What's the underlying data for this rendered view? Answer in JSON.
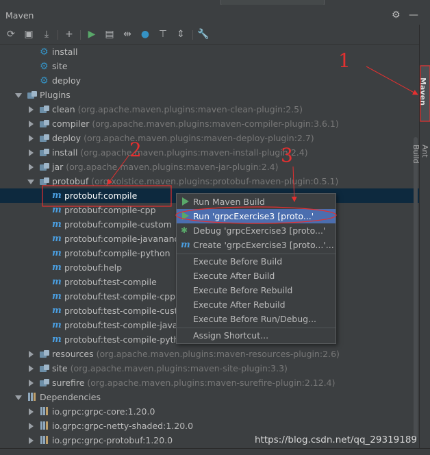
{
  "panel": {
    "title": "Maven"
  },
  "toolbar": {
    "icons": [
      "refresh-icon",
      "folder-add-icon",
      "download-icon",
      "plus-icon",
      "run-icon",
      "run-config-icon",
      "toggle-offline-icon",
      "skip-tests-icon",
      "collapse-icon",
      "expand-icon",
      "settings-wrench-icon"
    ]
  },
  "tree": {
    "lifecycle": [
      "install",
      "site",
      "deploy"
    ],
    "plugins_label": "Plugins",
    "plugins": [
      {
        "name": "clean",
        "artifact": "(org.apache.maven.plugins:maven-clean-plugin:2.5)"
      },
      {
        "name": "compiler",
        "artifact": "(org.apache.maven.plugins:maven-compiler-plugin:3.6.1)"
      },
      {
        "name": "deploy",
        "artifact": "(org.apache.maven.plugins:maven-deploy-plugin:2.7)"
      },
      {
        "name": "install",
        "artifact": "(org.apache.maven.plugins:maven-install-plugin:2.4)"
      },
      {
        "name": "jar",
        "artifact": "(org.apache.maven.plugins:maven-jar-plugin:2.4)"
      },
      {
        "name": "protobuf",
        "artifact": "(org.xolstice.maven.plugins:protobuf-maven-plugin:0.5.1)"
      }
    ],
    "goals": [
      "protobuf:compile",
      "protobuf:compile-cpp",
      "protobuf:compile-custom",
      "protobuf:compile-javanano",
      "protobuf:compile-python",
      "protobuf:help",
      "protobuf:test-compile",
      "protobuf:test-compile-cpp",
      "protobuf:test-compile-custom",
      "protobuf:test-compile-javanano",
      "protobuf:test-compile-python"
    ],
    "plugins_after": [
      {
        "name": "resources",
        "artifact": "(org.apache.maven.plugins:maven-resources-plugin:2.6)"
      },
      {
        "name": "site",
        "artifact": "(org.apache.maven.plugins:maven-site-plugin:3.3)"
      },
      {
        "name": "surefire",
        "artifact": "(org.apache.maven.plugins:maven-surefire-plugin:2.12.4)"
      }
    ],
    "dependencies_label": "Dependencies",
    "dependencies": [
      "io.grpc:grpc-core:1.20.0",
      "io.grpc:grpc-netty-shaded:1.20.0",
      "io.grpc:grpc-protobuf:1.20.0"
    ]
  },
  "context_menu": {
    "items": [
      {
        "label": "Run Maven Build",
        "icon": "run-icon"
      },
      {
        "label": "Run 'grpcExercise3 [proto...'",
        "icon": "run-icon",
        "highlighted": true
      },
      {
        "label": "Debug 'grpcExercise3 [proto...'",
        "icon": "debug-icon"
      },
      {
        "label": "Create 'grpcExercise3 [proto...'...",
        "icon": "maven-icon"
      },
      {
        "label": "Execute Before Build"
      },
      {
        "label": "Execute After Build"
      },
      {
        "label": "Execute Before Rebuild"
      },
      {
        "label": "Execute After Rebuild"
      },
      {
        "label": "Execute Before Run/Debug..."
      },
      {
        "label": "Assign Shortcut..."
      }
    ]
  },
  "side_tabs": {
    "maven": "Maven",
    "ant": "Ant Build"
  },
  "annotations": {
    "one": "1",
    "two": "2",
    "three": "3"
  },
  "watermark": "https://blog.csdn.net/qq_29319189",
  "colors": {
    "background": "#3c3f41",
    "selection": "#0d293e",
    "menu_highlight": "#4b6eaf",
    "annotation": "#e53030"
  }
}
